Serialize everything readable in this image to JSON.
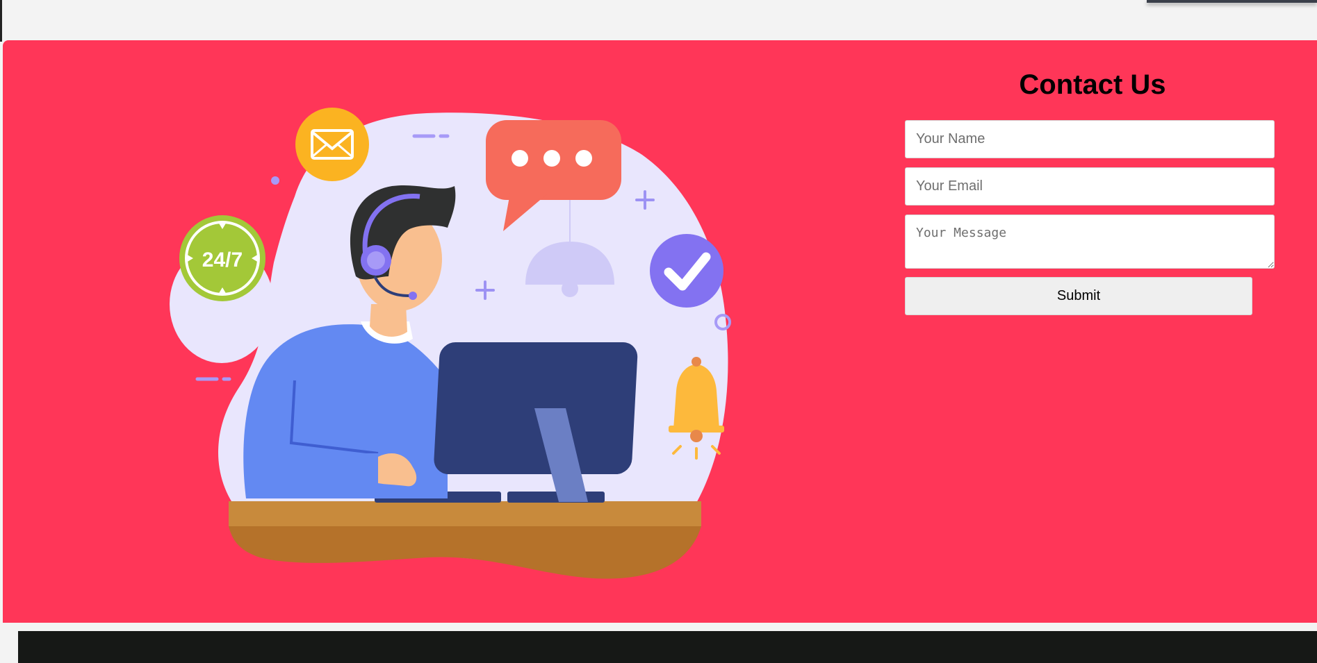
{
  "contact": {
    "title": "Contact Us",
    "name_placeholder": "Your Name",
    "email_placeholder": "Your Email",
    "message_placeholder": "Your Message",
    "submit_label": "Submit"
  },
  "illustration": {
    "badge_text": "24/7",
    "icons": [
      "mail-icon",
      "speech-bubble-icon",
      "checkmark-icon",
      "bell-icon",
      "clock-24-7-icon",
      "lamp-icon",
      "headset-icon",
      "monitor-icon",
      "keyboard-icon"
    ]
  },
  "colors": {
    "section_background": "#ff3658",
    "footer_background": "#161816",
    "blob": "#e9e6fd",
    "mail_circle": "#fbb321",
    "speech_bubble": "#f66b5b",
    "check_circle": "#8372f1",
    "badge_green": "#a3c838",
    "bell": "#fdb93c",
    "shirt": "#6389f2",
    "monitor": "#2e3e78",
    "desk_top": "#c88a3c",
    "desk_front": "#b5722a"
  }
}
